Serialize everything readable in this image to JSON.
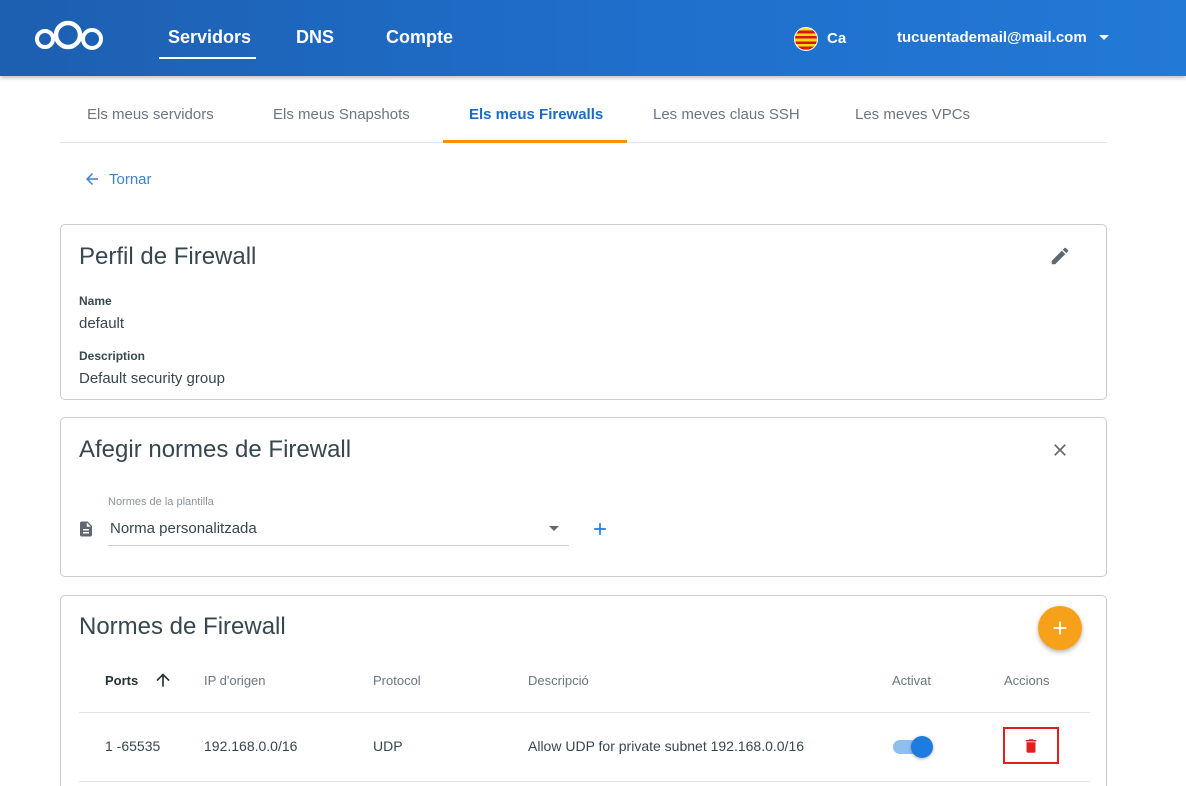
{
  "header": {
    "nav": [
      "Servidors",
      "DNS",
      "Compte"
    ],
    "lang": "Ca",
    "user_email": "tucuentademail@mail.com"
  },
  "tabs": [
    "Els meus servidors",
    "Els meus Snapshots",
    "Els meus Firewalls",
    "Les meves claus SSH",
    "Les meves VPCs"
  ],
  "active_tab": "Els meus Firewalls",
  "back_label": "Tornar",
  "profile": {
    "title": "Perfil de Firewall",
    "name_label": "Name",
    "name_value": "default",
    "description_label": "Description",
    "description_value": "Default security group"
  },
  "add_rules": {
    "title": "Afegir normes de Firewall",
    "template_label": "Normes de la plantilla",
    "template_value": "Norma personalitzada"
  },
  "rules": {
    "title": "Normes de Firewall",
    "columns": [
      "Ports",
      "IP d'origen",
      "Protocol",
      "Descripció",
      "Activat",
      "Accions"
    ],
    "rows": [
      {
        "ports": "1 -65535",
        "source_ip": "192.168.0.0/16",
        "protocol": "UDP",
        "description": "Allow UDP for private subnet 192.168.0.0/16",
        "enabled": true
      }
    ]
  },
  "colors": {
    "header_blue": "#1f6fcc",
    "tab_accent": "#f39400",
    "fab_orange": "#f7a11a",
    "delete_red": "#e02020",
    "toggle_blue": "#1e7be0"
  },
  "icons": [
    "nextcloud-logo",
    "catalan-flag-icon",
    "chevron-down-icon",
    "arrow-left-icon",
    "pencil-icon",
    "close-icon",
    "document-icon",
    "plus-icon",
    "arrow-up-icon",
    "trash-icon"
  ]
}
